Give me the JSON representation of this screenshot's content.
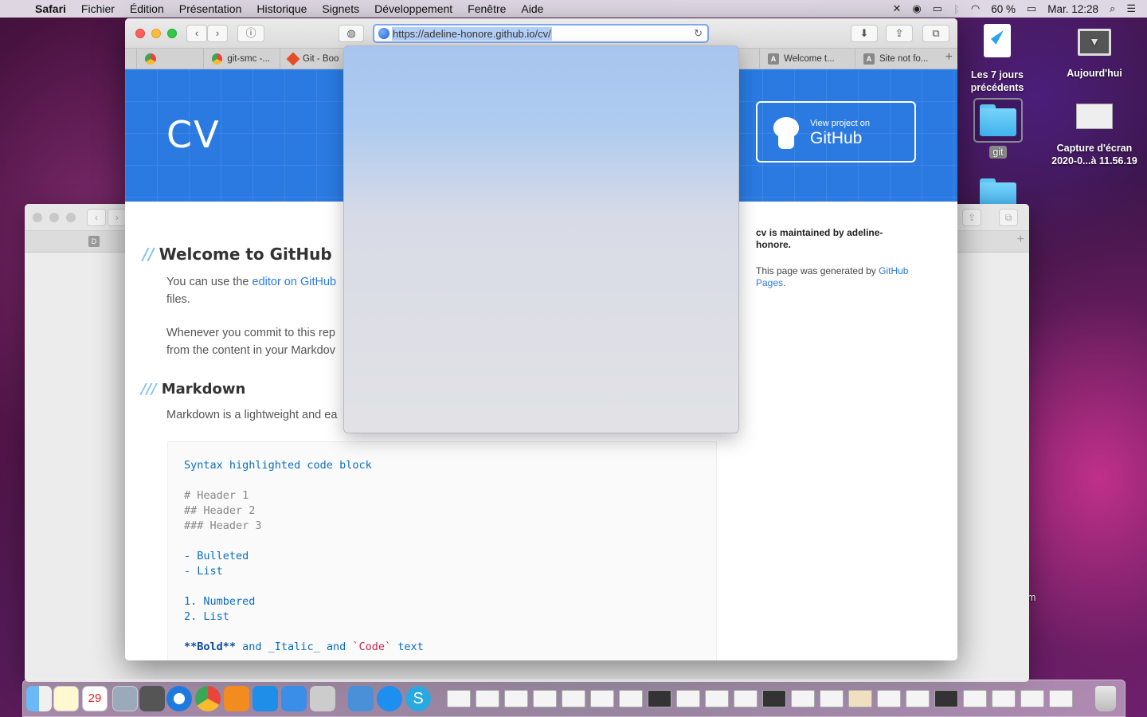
{
  "menubar": {
    "app": "Safari",
    "items": [
      "Fichier",
      "Édition",
      "Présentation",
      "Historique",
      "Signets",
      "Développement",
      "Fenêtre",
      "Aide"
    ],
    "battery": "60 %",
    "clock": "Mar. 12:28"
  },
  "desktop": {
    "icons": [
      {
        "label": "Les 7 jours précédents"
      },
      {
        "label": "Aujourd'hui"
      },
      {
        "label": "git"
      },
      {
        "label": "Capture d'écran 2020-0...à 11.56.19"
      }
    ],
    "partial_text": "m"
  },
  "browser": {
    "url": "https://adeline-honore.github.io/cv/",
    "tabs": [
      {
        "label": "git-smc -..."
      },
      {
        "label": "Git - Boo"
      },
      {
        "label": "Welcome t..."
      },
      {
        "label": "Site not fo..."
      }
    ],
    "new_tab": "+"
  },
  "page": {
    "site_title": "CV",
    "github_small": "View project on",
    "github_big": "GitHub",
    "heading1": "Welcome to GitHub",
    "para1_a": "You can use the ",
    "para1_link": "editor on GitHub",
    "para1_b": "files.",
    "para2_a": "Whenever you commit to this rep",
    "para2_b": "from the content in your Markdov",
    "heading2": "Markdown",
    "para3": "Markdown is a lightweight and ea",
    "code": {
      "line1": "Syntax highlighted code block",
      "h1": "# Header 1",
      "h2": "## Header 2",
      "h3": "### Header 3",
      "b1": "- Bulleted",
      "b2": "- List",
      "n1": "1. Numbered",
      "n2": "2. List",
      "bold": "**Bold**",
      "and1": " and ",
      "italic": "_Italic_",
      "and2": " and ",
      "codeword": "`Code`",
      "text": " text"
    },
    "sidebar": {
      "repo": "cv",
      "maintained": " is maintained by ",
      "owner": "adeline-honore",
      "dot": ".",
      "generated": "This page was generated by ",
      "pages": "GitHub Pages",
      "dot2": "."
    }
  },
  "colors": {
    "header": "#2a7ae2",
    "link": "#2a7ae2"
  }
}
